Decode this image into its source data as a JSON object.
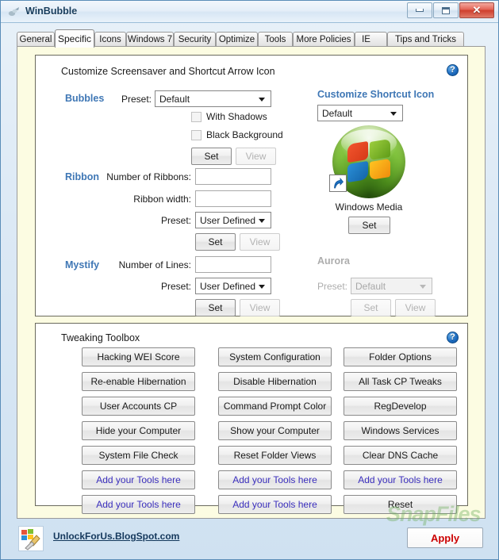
{
  "window": {
    "title": "WinBubble",
    "icon": "app-icon",
    "controls": {
      "minimize": "minimize",
      "maximize": "maximize",
      "close": "✕"
    }
  },
  "tabs": [
    {
      "label": "General",
      "active": false
    },
    {
      "label": "Specific",
      "active": true
    },
    {
      "label": "Icons",
      "active": false
    },
    {
      "label": "Windows 7",
      "active": false
    },
    {
      "label": "Security",
      "active": false
    },
    {
      "label": "Optimize",
      "active": false
    },
    {
      "label": "Tools",
      "active": false
    },
    {
      "label": "More Policies",
      "active": false
    },
    {
      "label": "IE",
      "active": false
    },
    {
      "label": "Tips and Tricks",
      "active": false
    }
  ],
  "screensaver_panel": {
    "title": "Customize Screensaver and Shortcut Arrow Icon",
    "help_icon": "help-icon",
    "help_glyph": "?",
    "bubbles": {
      "label": "Bubbles",
      "preset_label": "Preset:",
      "preset_value": "Default",
      "checkbox_shadows": "With Shadows",
      "checkbox_black_bg": "Black Background",
      "set_label": "Set",
      "view_label": "View"
    },
    "ribbon": {
      "label": "Ribbon",
      "number_label": "Number of Ribbons:",
      "number_value": "",
      "width_label": "Ribbon width:",
      "width_value": "",
      "preset_label": "Preset:",
      "preset_value": "User Defined",
      "set_label": "Set",
      "view_label": "View"
    },
    "mystify": {
      "label": "Mystify",
      "lines_label": "Number of Lines:",
      "lines_value": "",
      "preset_label": "Preset:",
      "preset_value": "User Defined",
      "set_label": "Set",
      "view_label": "View"
    },
    "shortcut_icon": {
      "label": "Customize Shortcut Icon",
      "preset_value": "Default",
      "preview_caption": "Windows Media",
      "set_label": "Set",
      "badge_icon": "shortcut-arrow-icon"
    },
    "aurora": {
      "label": "Aurora",
      "preset_label": "Preset:",
      "preset_value": "Default",
      "set_label": "Set",
      "view_label": "View"
    }
  },
  "toolbox_panel": {
    "title": "Tweaking Toolbox",
    "help_icon": "help-icon",
    "help_glyph": "?",
    "columns": [
      {
        "buttons": [
          {
            "label": "Hacking WEI Score",
            "style": "normal"
          },
          {
            "label": "Re-enable Hibernation",
            "style": "normal"
          },
          {
            "label": "User Accounts CP",
            "style": "normal"
          },
          {
            "label": "Hide your Computer",
            "style": "normal"
          },
          {
            "label": "System File Check",
            "style": "normal"
          },
          {
            "label": "Add your Tools here",
            "style": "addtool"
          },
          {
            "label": "Add your Tools here",
            "style": "addtool"
          }
        ]
      },
      {
        "buttons": [
          {
            "label": "System Configuration",
            "style": "normal"
          },
          {
            "label": "Disable Hibernation",
            "style": "normal"
          },
          {
            "label": "Command Prompt Color",
            "style": "normal"
          },
          {
            "label": "Show your Computer",
            "style": "normal"
          },
          {
            "label": "Reset Folder Views",
            "style": "normal"
          },
          {
            "label": "Add your Tools here",
            "style": "addtool"
          },
          {
            "label": "Add your Tools here",
            "style": "addtool"
          }
        ]
      },
      {
        "buttons": [
          {
            "label": "Folder Options",
            "style": "normal"
          },
          {
            "label": "All Task CP Tweaks",
            "style": "normal"
          },
          {
            "label": "RegDevelop",
            "style": "normal"
          },
          {
            "label": "Windows Services",
            "style": "normal"
          },
          {
            "label": "Clear DNS Cache",
            "style": "normal"
          },
          {
            "label": "Add your Tools here",
            "style": "addtool"
          },
          {
            "label": "Reset",
            "style": "normal"
          }
        ]
      }
    ]
  },
  "footer": {
    "icon": "winbubble-tool-icon",
    "link": "UnlockForUs.BlogSpot.com",
    "apply_label": "Apply"
  },
  "watermark": "SnapFiles",
  "colors": {
    "accent_blue": "#3f77b5",
    "tab_page_bg": "#fcfce2",
    "window_chrome": "#cfe1f1",
    "apply_red": "#cc0000",
    "addtool_text": "#3b2fbd",
    "disabled_gray": "#adadad"
  }
}
